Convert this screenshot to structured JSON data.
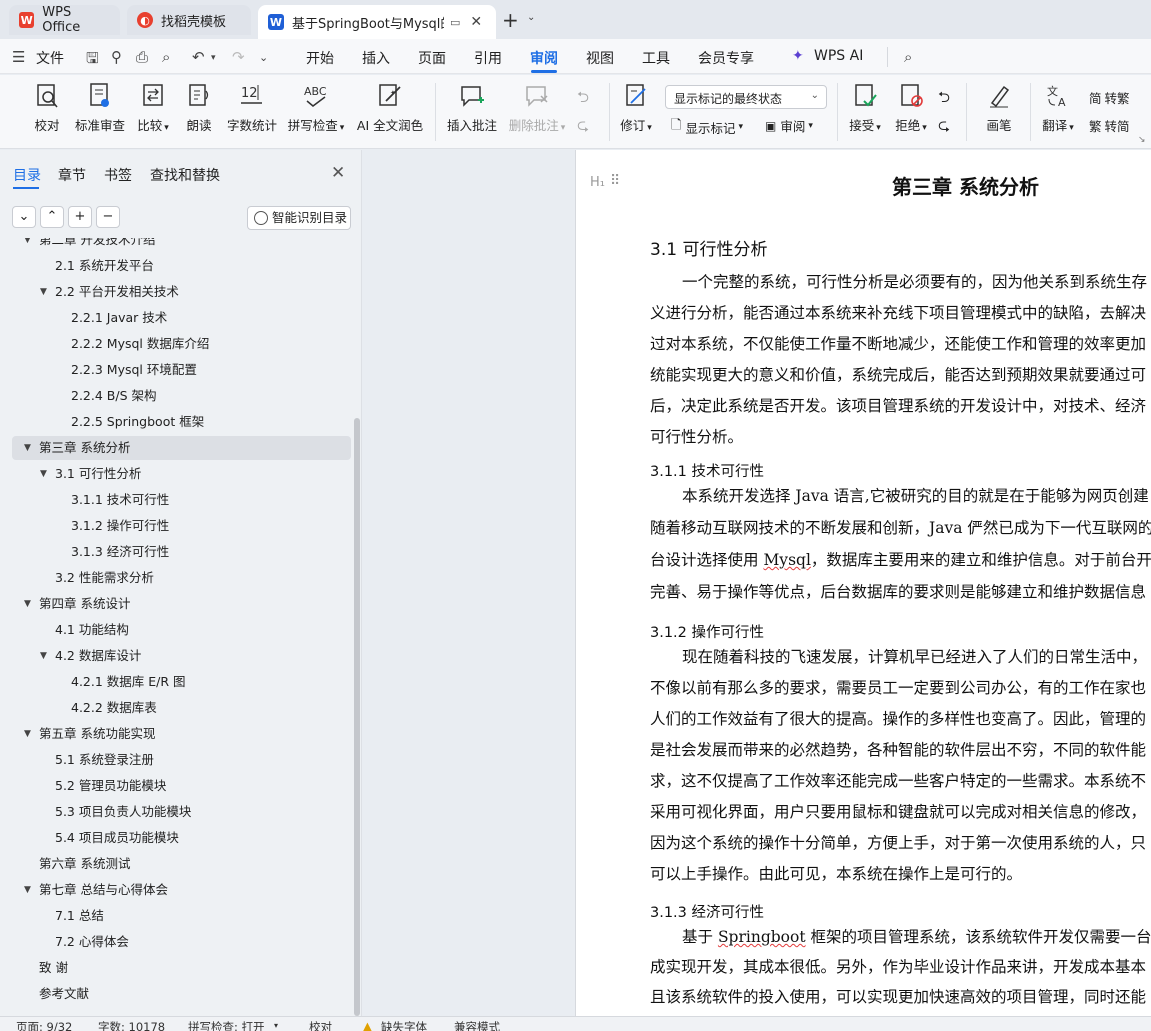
{
  "tabs": [
    {
      "label": "WPS Office",
      "logo": "W",
      "logo_color": "#e8402f"
    },
    {
      "label": "找稻壳模板",
      "logo": "D",
      "logo_color": "#e8402f"
    },
    {
      "label": "基于SpringBoot与Mysql的项",
      "logo": "W",
      "logo_color": "#1f5fd6"
    }
  ],
  "menu": {
    "file": "文件",
    "items": [
      "开始",
      "插入",
      "页面",
      "引用",
      "审阅",
      "视图",
      "工具",
      "会员专享"
    ],
    "active": "审阅",
    "ai": "WPS AI"
  },
  "ribbon": {
    "proofread": "校对",
    "standard_review": "标准审查",
    "compare": "比较",
    "read_aloud": "朗读",
    "word_count": "字数统计",
    "spell_check": "拼写检查",
    "ai_polish": "AI 全文润色",
    "insert_comment": "插入批注",
    "delete_comment": "删除批注",
    "display_select": "显示标记的最终状态",
    "revise": "修订",
    "show_markup": "显示标记",
    "review": "审阅",
    "accept": "接受",
    "reject": "拒绝",
    "pen": "画笔",
    "translate": "翻译",
    "to_traditional": "转繁",
    "to_simplified": "转简"
  },
  "panel": {
    "tabs": [
      "目录",
      "章节",
      "书签",
      "查找和替换"
    ],
    "smart_toc": "智能识别目录",
    "toc": [
      {
        "label": "第二章  开发技术介绍",
        "level": 0,
        "arrow": true
      },
      {
        "label": "2.1  系统开发平台",
        "level": 1,
        "arrow": false
      },
      {
        "label": "2.2  平台开发相关技术",
        "level": 1,
        "arrow": true
      },
      {
        "label": "2.2.1   Javar 技术",
        "level": 2,
        "arrow": false
      },
      {
        "label": "2.2.2   Mysql 数据库介绍",
        "level": 2,
        "arrow": false
      },
      {
        "label": "2.2.3   Mysql 环境配置",
        "level": 2,
        "arrow": false
      },
      {
        "label": "2.2.4   B/S 架构",
        "level": 2,
        "arrow": false
      },
      {
        "label": "2.2.5   Springboot 框架",
        "level": 2,
        "arrow": false
      },
      {
        "label": "第三章  系统分析",
        "level": 0,
        "arrow": true,
        "selected": true
      },
      {
        "label": "3.1  可行性分析",
        "level": 1,
        "arrow": true
      },
      {
        "label": "3.1.1 技术可行性",
        "level": 2,
        "arrow": false
      },
      {
        "label": "3.1.2 操作可行性",
        "level": 2,
        "arrow": false
      },
      {
        "label": "3.1.3 经济可行性",
        "level": 2,
        "arrow": false
      },
      {
        "label": "3.2 性能需求分析",
        "level": 1,
        "arrow": false
      },
      {
        "label": "第四章  系统设计",
        "level": 0,
        "arrow": true
      },
      {
        "label": "4.1 功能结构",
        "level": 1,
        "arrow": false
      },
      {
        "label": "4.2  数据库设计",
        "level": 1,
        "arrow": true
      },
      {
        "label": "4.2.1  数据库 E/R 图",
        "level": 2,
        "arrow": false
      },
      {
        "label": "4.2.2  数据库表",
        "level": 2,
        "arrow": false
      },
      {
        "label": "第五章  系统功能实现",
        "level": 0,
        "arrow": true
      },
      {
        "label": "5.1 系统登录注册",
        "level": 1,
        "arrow": false
      },
      {
        "label": "5.2 管理员功能模块",
        "level": 1,
        "arrow": false
      },
      {
        "label": "5.3 项目负责人功能模块",
        "level": 1,
        "arrow": false
      },
      {
        "label": "5.4 项目成员功能模块",
        "level": 1,
        "arrow": false
      },
      {
        "label": "第六章  系统测试",
        "level": 0,
        "arrow": false
      },
      {
        "label": "第七章  总结与心得体会",
        "level": 0,
        "arrow": true
      },
      {
        "label": "7.1 总结",
        "level": 1,
        "arrow": false
      },
      {
        "label": "7.2 心得体会",
        "level": 1,
        "arrow": false
      },
      {
        "label": "致    谢",
        "level": 0,
        "arrow": false
      },
      {
        "label": "参考文献",
        "level": 0,
        "arrow": false
      }
    ]
  },
  "document": {
    "heading_icon": "H₁",
    "chapter_title": "第三章  系统分析",
    "section_title": "3.1  可行性分析",
    "sub1_title": "3.1.1 技术可行性",
    "sub2_title": "3.1.2 操作可行性",
    "sub3_title": "3.1.3 经济可行性",
    "p1": [
      "一个完整的系统，可行性分析是必须要有的，因为他关系到系统生存",
      "义进行分析，能否通过本系统来补充线下项目管理模式中的缺陷，去解决",
      "过对本系统，不仅能使工作量不断地减少，还能使工作和管理的效率更加",
      "统能实现更大的意义和价值，系统完成后，能否达到预期效果就要通过可",
      "后，决定此系统是否开发。该项目管理系统的开发设计中，对技术、经济",
      "可行性分析。"
    ],
    "p2": [
      "本系统开发选择 Java 语言,它被研究的目的就是在于能够为网页创建",
      "随着移动互联网技术的不断发展和创新，Java 俨然已成为下一代互联网的",
      [
        "台设计选择使用 ",
        "Mysql",
        "，数据库主要用来的建立和维护信息。对于前台开"
      ],
      "完善、易于操作等优点，后台数据库的要求则是能够建立和维护数据信息"
    ],
    "p3": [
      "现在随着科技的飞速发展，计算机早已经进入了人们的日常生活中，",
      "不像以前有那么多的要求，需要员工一定要到公司办公，有的工作在家也",
      "人们的工作效益有了很大的提高。操作的多样性也变高了。因此，管理的",
      "是社会发展而带来的必然趋势，各种智能的软件层出不穷，不同的软件能",
      "求，这不仅提高了工作效率还能完成一些客户特定的一些需求。本系统不",
      "采用可视化界面，用户只要用鼠标和键盘就可以完成对相关信息的修改，",
      "因为这个系统的操作十分简单，方便上手，对于第一次使用系统的人，只",
      "可以上手操作。由此可见，本系统在操作上是可行的。"
    ],
    "p4": [
      [
        "基于 ",
        "Springboot",
        " 框架的项目管理系统，该系统软件开发仅需要一台普"
      ],
      "成实现开发，其成本很低。另外，作为毕业设计作品来讲，开发成本基本",
      "且该系统软件的投入使用，可以实现更加快速高效的项目管理，同时还能"
    ]
  },
  "status": {
    "page": "页面: 9/32",
    "words": "字数: 10178",
    "spell": "拼写检查: 打开",
    "proof": "校对",
    "missing_font": "缺失字体",
    "compat": "兼容模式"
  }
}
